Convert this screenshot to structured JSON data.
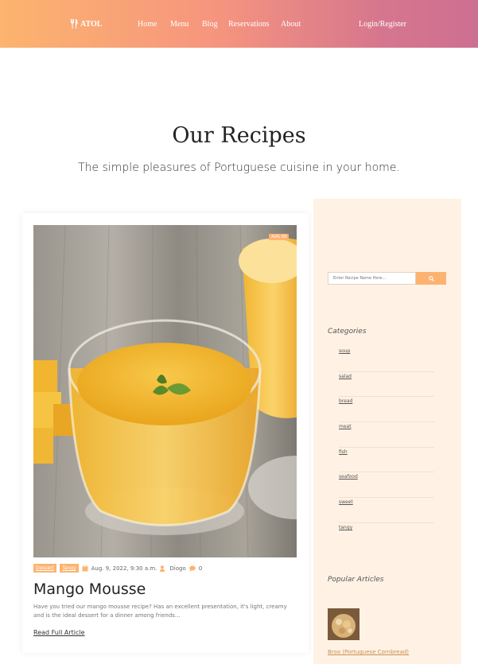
{
  "navbar": {
    "brand": "ATOL",
    "links": [
      "Home",
      "Menu",
      "Blog",
      "Reservations",
      "About"
    ],
    "login": "Login/Register"
  },
  "hero": {
    "title": "Our Recipes",
    "subtitle": "The simple pleasures of Portuguese cuisine in your home."
  },
  "article": {
    "date_badge": "AUG 09",
    "tags": [
      "Dessert",
      "Tangy"
    ],
    "date": "Aug. 9, 2022, 9:30 a.m.",
    "author": "Diogo",
    "comments": "0",
    "title": "Mango Mousse",
    "excerpt": "Have you tried our mango mousse recipe? Has an excellent presentation, it's light, creamy and is the ideal dessert for a dinner among friends...",
    "read_more": "Read Full Article"
  },
  "sidebar": {
    "search_placeholder": "Enter Recipe Name Here...",
    "categories_heading": "Categories",
    "categories": [
      "soup",
      "salad",
      "bread",
      "meat",
      "fish",
      "seafood",
      "sweet",
      "tangy"
    ],
    "popular_heading": "Popular Articles",
    "popular": [
      {
        "title": "Broa (Portuguese Cornbread)"
      }
    ]
  },
  "colors": {
    "accent": "#fdb370",
    "sidebar_bg": "#fff2e4",
    "header_start": "#fcb46e",
    "header_end": "#cd6f91"
  }
}
